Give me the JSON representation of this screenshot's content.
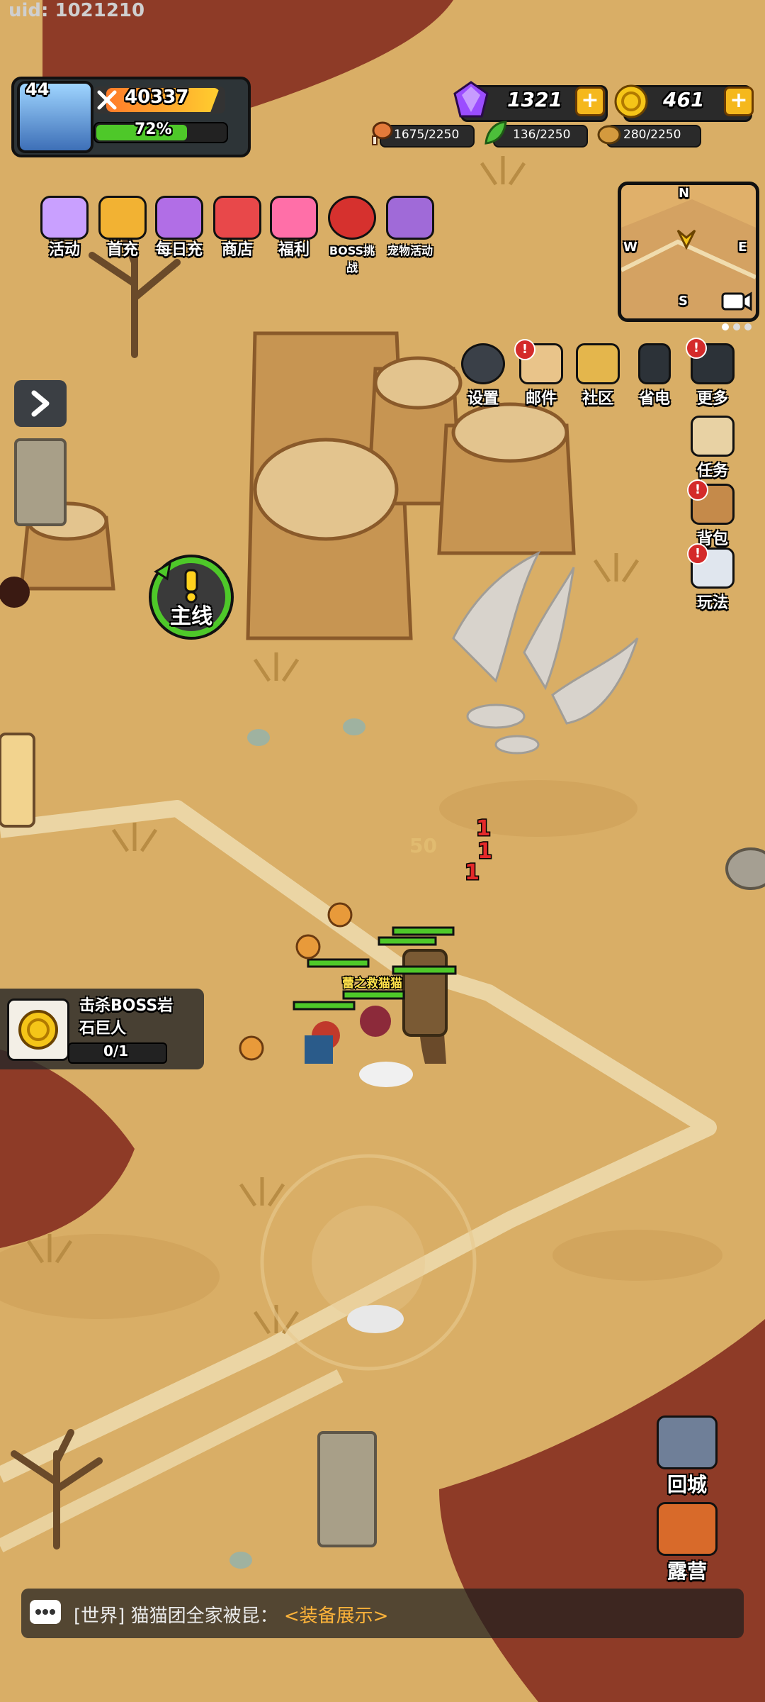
{
  "uid": "uid: 1021210",
  "player": {
    "level": "44",
    "power": "40337",
    "exp_text": "72%",
    "exp_fraction": 0.72
  },
  "currency": {
    "gems": "1321",
    "gold": "461"
  },
  "resources": [
    {
      "icon": "drumstick-icon",
      "value": "1675/2250"
    },
    {
      "icon": "leaf-icon",
      "value": "136/2250"
    },
    {
      "icon": "ore-icon",
      "value": "280/2250"
    }
  ],
  "menu": [
    {
      "label": "活动",
      "icon": "event-icon",
      "color": "#c9a0ff"
    },
    {
      "label": "首充",
      "icon": "first-recharge-icon",
      "color": "#f2b233"
    },
    {
      "label": "每日充",
      "icon": "daily-recharge-icon",
      "color": "#b16ee6"
    },
    {
      "label": "商店",
      "icon": "shop-icon",
      "color": "#e8484a"
    },
    {
      "label": "福利",
      "icon": "gift-icon",
      "color": "#ff6fa8"
    },
    {
      "label": "BOSS挑战",
      "icon": "boss-challenge-icon",
      "color": "#d6312e"
    },
    {
      "label": "宠物活动",
      "icon": "pet-event-icon",
      "color": "#a06ad8"
    }
  ],
  "minimap": {
    "n": "N",
    "s": "S",
    "w": "W",
    "e": "E"
  },
  "system": [
    {
      "label": "设置",
      "icon": "gear-icon",
      "color": "#3a4048"
    },
    {
      "label": "邮件",
      "icon": "mail-icon",
      "color": "#e9c48a"
    },
    {
      "label": "社区",
      "icon": "community-icon",
      "color": "#e4b64c"
    },
    {
      "label": "省电",
      "icon": "battery-icon",
      "color": "#2c3238"
    },
    {
      "label": "更多",
      "icon": "more-icon",
      "color": "#2c3238"
    }
  ],
  "side": [
    {
      "label": "任务",
      "icon": "scroll-icon",
      "color": "#e8d2a4"
    },
    {
      "label": "背包",
      "icon": "backpack-icon",
      "color": "#c58a4a"
    },
    {
      "label": "玩法",
      "icon": "gameplay-icon",
      "color": "#e0e6ee"
    }
  ],
  "mainquest": "主线",
  "quest": {
    "line1": "击杀BOSS岩",
    "line2": "石巨人",
    "progress": "0/1"
  },
  "map_text": {
    "ally_name": "蕾之救猫猫",
    "num50": "50",
    "damage": [
      "1",
      "1",
      "1"
    ]
  },
  "return_city": "回城",
  "camp": "露营",
  "chat": {
    "channel": "[世界]",
    "name": "猫猫团全家被昆：",
    "link": "<装备展示>"
  }
}
